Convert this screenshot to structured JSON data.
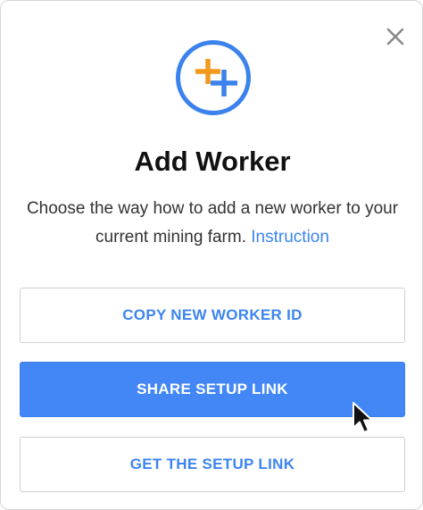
{
  "dialog": {
    "title": "Add Worker",
    "description": "Choose the way how to add a new worker to your current mining farm.",
    "instruction_link": "Instruction",
    "buttons": {
      "copy_id": "COPY NEW WORKER ID",
      "share_link": "SHARE SETUP LINK",
      "get_link": "GET THE SETUP LINK"
    }
  },
  "icons": {
    "close": "close-icon",
    "logo": "add-worker-logo-icon",
    "cursor": "mouse-pointer-icon"
  },
  "colors": {
    "accent_blue": "#3d85f0",
    "primary_button": "#4287f5",
    "logo_orange": "#f39a1e",
    "logo_blue": "#3b82ec"
  }
}
